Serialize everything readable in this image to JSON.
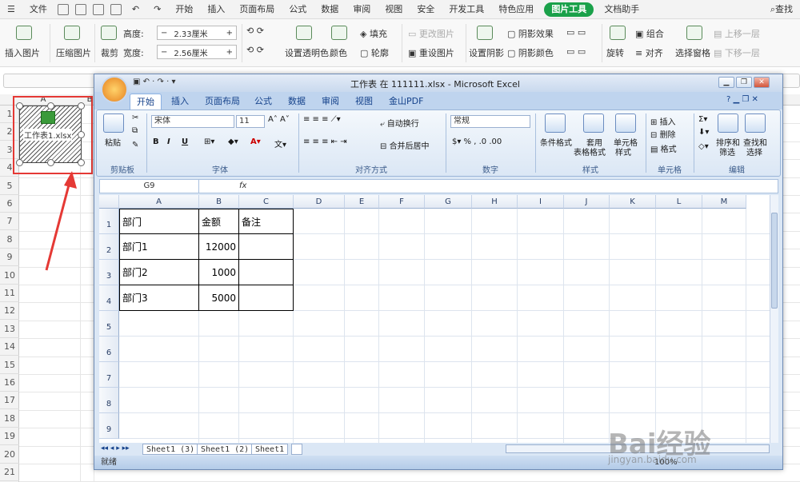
{
  "wps": {
    "menu": {
      "items": [
        "文件",
        "开始",
        "插入",
        "页面布局",
        "公式",
        "数据",
        "审阅",
        "视图",
        "安全",
        "开发工具",
        "特色应用",
        "图片工具",
        "文档助手"
      ],
      "active": "图片工具",
      "search": "查找"
    },
    "ribbon": {
      "insert_picture": "插入图片",
      "compress": "压缩图片",
      "crop": "裁剪",
      "height_label": "高度:",
      "height_value": "2.33厘米",
      "width_label": "宽度:",
      "width_value": "2.56厘米",
      "transparent": "设置透明色",
      "color": "颜色",
      "fill": "填充",
      "outline": "轮廓",
      "change_pic": "更改图片",
      "reset_pic": "重设图片",
      "set_shadow": "设置阴影",
      "shadow_effect": "阴影效果",
      "shadow_color": "阴影颜色",
      "rotate": "旋转",
      "group": "组合",
      "align": "对齐",
      "select_pane": "选择窗格",
      "bring_forward": "上移一层",
      "send_backward": "下移一层"
    },
    "rows": [
      "1",
      "2",
      "3",
      "4",
      "5",
      "6",
      "7",
      "8",
      "9",
      "10",
      "11",
      "12",
      "13",
      "14",
      "15",
      "16",
      "17",
      "18",
      "19",
      "20",
      "21"
    ],
    "cols": [
      "A",
      "B"
    ],
    "object_label": "工作表1.xlsx"
  },
  "excel": {
    "title": "工作表 在 111111.xlsx - Microsoft Excel",
    "tabs": [
      "开始",
      "插入",
      "页面布局",
      "公式",
      "数据",
      "审阅",
      "视图",
      "金山PDF"
    ],
    "active_tab": "开始",
    "ribbon": {
      "paste": "粘贴",
      "clipboard": "剪贴板",
      "font_name": "宋体",
      "font_size": "11",
      "font_group": "字体",
      "bold": "B",
      "italic": "I",
      "underline": "U",
      "wrap": "自动换行",
      "merge": "合并后居中",
      "align_group": "对齐方式",
      "number_format": "常规",
      "number_group": "数字",
      "cond_format": "条件格式",
      "table_format_1": "套用",
      "table_format_2": "表格格式",
      "cell_style_1": "单元格",
      "cell_style_2": "样式",
      "style_group": "样式",
      "insert": "插入",
      "delete": "删除",
      "format": "格式",
      "cells_group": "单元格",
      "sort_1": "排序和",
      "sort_2": "筛选",
      "find_1": "查找和",
      "find_2": "选择",
      "edit_group": "编辑"
    },
    "name_box": "G9",
    "fx": "fx",
    "columns": [
      "A",
      "B",
      "C",
      "D",
      "E",
      "F",
      "G",
      "H",
      "I",
      "J",
      "K",
      "L",
      "M"
    ],
    "rows": [
      "1",
      "2",
      "3",
      "4",
      "5",
      "6",
      "7",
      "8",
      "9"
    ],
    "table": [
      [
        "部门",
        "金额",
        "备注"
      ],
      [
        "部门1",
        "12000",
        ""
      ],
      [
        "部门2",
        "1000",
        ""
      ],
      [
        "部门3",
        "5000",
        ""
      ]
    ],
    "sheets": [
      "Sheet1 (3)",
      "Sheet1 (2)",
      "Sheet1"
    ],
    "status": "就绪",
    "zoom": "100%"
  },
  "watermark": {
    "text": "Bai经验",
    "url": "jingyan.baidu.com"
  }
}
